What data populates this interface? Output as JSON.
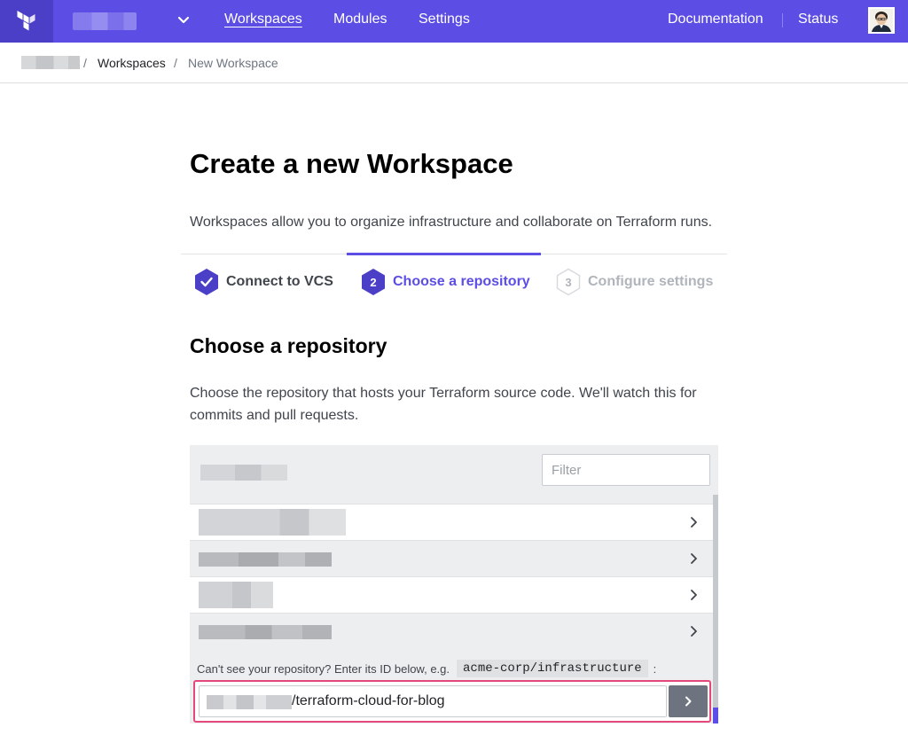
{
  "nav": {
    "workspaces": "Workspaces",
    "modules": "Modules",
    "settings": "Settings",
    "documentation": "Documentation",
    "status": "Status"
  },
  "breadcrumb": {
    "sep1": "/",
    "workspaces": "Workspaces",
    "sep2": "/",
    "current": "New Workspace"
  },
  "page": {
    "title": "Create a new Workspace",
    "intro": "Workspaces allow you to organize infrastructure and collaborate on Terraform runs."
  },
  "steps": [
    {
      "number": "",
      "label": "Connect to VCS",
      "state": "done"
    },
    {
      "number": "2",
      "label": "Choose a repository",
      "state": "current"
    },
    {
      "number": "3",
      "label": "Configure settings",
      "state": "future"
    }
  ],
  "section": {
    "title": "Choose a repository",
    "description": "Choose the repository that hosts your Terraform source code. We'll watch this for commits and pull requests."
  },
  "repo_panel": {
    "filter_placeholder": "Filter",
    "hint_prefix": "Can't see your repository? Enter its ID below, e.g.",
    "hint_example": "acme-corp/infrastructure",
    "hint_suffix": ":",
    "repo_id_suffix": "/terraform-cloud-for-blog"
  },
  "colors": {
    "brand": "#5c4ee5",
    "highlight_border": "#e5487a",
    "button": "#6d7480"
  }
}
